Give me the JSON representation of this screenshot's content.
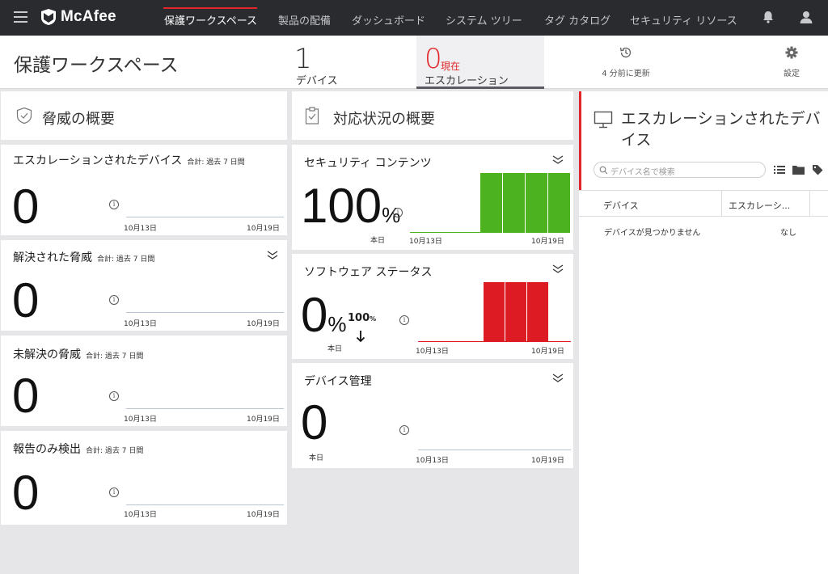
{
  "brand": {
    "name": "McAfee"
  },
  "nav": {
    "items": [
      "保護ワークスペース",
      "製品の配備",
      "ダッシュボード",
      "システム ツリー",
      "タグ カタログ",
      "セキュリティ リソース"
    ],
    "bell_icon": "bell-icon",
    "user_icon": "user-icon"
  },
  "header": {
    "title": "保護ワークスペース",
    "devices_count": "1",
    "devices_label": "デバイス",
    "escalation_count": "0",
    "escalation_current": "現在",
    "escalation_label": "エスカレーション",
    "updated": "4 分前に更新",
    "settings": "設定"
  },
  "threats": {
    "section_title": "脅威の概要",
    "widgets": [
      {
        "title": "エスカレーションされたデバイス",
        "sub": "合計: 過去 7 日間",
        "value": "0",
        "x_start": "10月13日",
        "x_end": "10月19日"
      },
      {
        "title": "解決された脅威",
        "sub": "合計: 過去 7 日間",
        "value": "0",
        "x_start": "10月13日",
        "x_end": "10月19日"
      },
      {
        "title": "未解決の脅威",
        "sub": "合計: 過去 7 日間",
        "value": "0",
        "x_start": "10月13日",
        "x_end": "10月19日"
      },
      {
        "title": "報告のみ検出",
        "sub": "合計: 過去 7 日間",
        "value": "0",
        "x_start": "10月13日",
        "x_end": "10月19日"
      }
    ]
  },
  "response": {
    "section_title": "対応状況の概要",
    "widgets": [
      {
        "title": "セキュリティ コンテンツ",
        "value": "100",
        "unit": "%",
        "today": "本日",
        "x_start": "10月13日",
        "x_end": "10月19日",
        "bar_color": "#4db21f"
      },
      {
        "title": "ソフトウェア ステータス",
        "value": "0",
        "unit": "%",
        "change": "100",
        "change_unit": "%",
        "today": "本日",
        "x_start": "10月13日",
        "x_end": "10月19日",
        "bar_color": "#dd1b22"
      },
      {
        "title": "デバイス管理",
        "value": "0",
        "today": "本日",
        "x_start": "10月13日",
        "x_end": "10月19日"
      }
    ]
  },
  "escalated_devices": {
    "title": "エスカレーションされたデバイス",
    "search_placeholder": "デバイス名で検索",
    "columns": [
      "デバイス",
      "エスカレーシ..."
    ],
    "empty_message": "デバイスが見つかりません",
    "empty_value": "なし"
  },
  "colors": {
    "accent": "#e0262a",
    "nav_bg": "#2a2b2f",
    "green": "#4db21f",
    "red": "#dd1b22"
  }
}
